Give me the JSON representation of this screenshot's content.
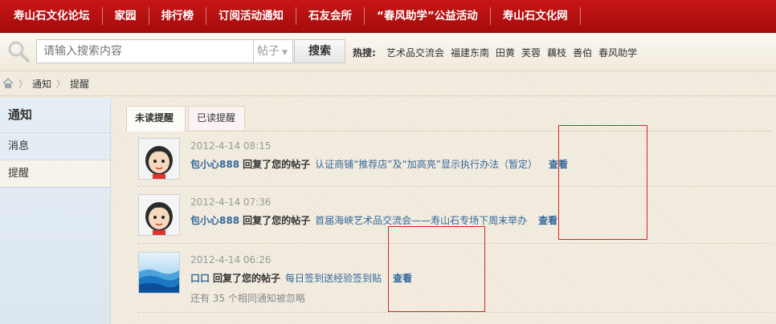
{
  "topnav": {
    "items": [
      "寿山石文化论坛",
      "家园",
      "排行榜",
      "订阅活动通知",
      "石友会所",
      "“春风助学”公益活动",
      "寿山石文化网"
    ]
  },
  "search": {
    "placeholder": "请输入搜索内容",
    "type_selected": "帖子",
    "button_label": "搜索",
    "hot_label": "热搜:",
    "hot_terms": [
      "艺术品交流会",
      "福建东南",
      "田黄",
      "芙蓉",
      "藕枝",
      "善伯",
      "春风助学"
    ]
  },
  "breadcrumb": {
    "items": [
      "通知",
      "提醒"
    ]
  },
  "sidebar": {
    "title": "通知",
    "items": [
      "消息",
      "提醒"
    ]
  },
  "tabs": {
    "unread": "未读提醒",
    "read": "已读提醒"
  },
  "notifications": [
    {
      "time": "2012-4-14 08:15",
      "user": "包小心888",
      "action": "回复了您的帖子",
      "thread": "认证商铺“推荐店”及“加高亮”显示执行办法（暂定）",
      "view": "查看",
      "avatar": "cartoon-face"
    },
    {
      "time": "2012-4-14 07:36",
      "user": "包小心888",
      "action": "回复了您的帖子",
      "thread": "首届海峡艺术品交流会——寿山石专场下周末举办",
      "view": "查看",
      "avatar": "cartoon-face"
    },
    {
      "time": "2012-4-14 06:26",
      "user": "口口",
      "action": "回复了您的帖子",
      "thread": "每日签到送经验签到贴",
      "view": "查看",
      "avatar": "blue-landscape"
    }
  ],
  "ignored_note": "还有 35 个相同通知被忽略",
  "colors": {
    "nav_red": "#b80f0f",
    "link_blue": "#336699",
    "annotation_red": "#d62525"
  }
}
